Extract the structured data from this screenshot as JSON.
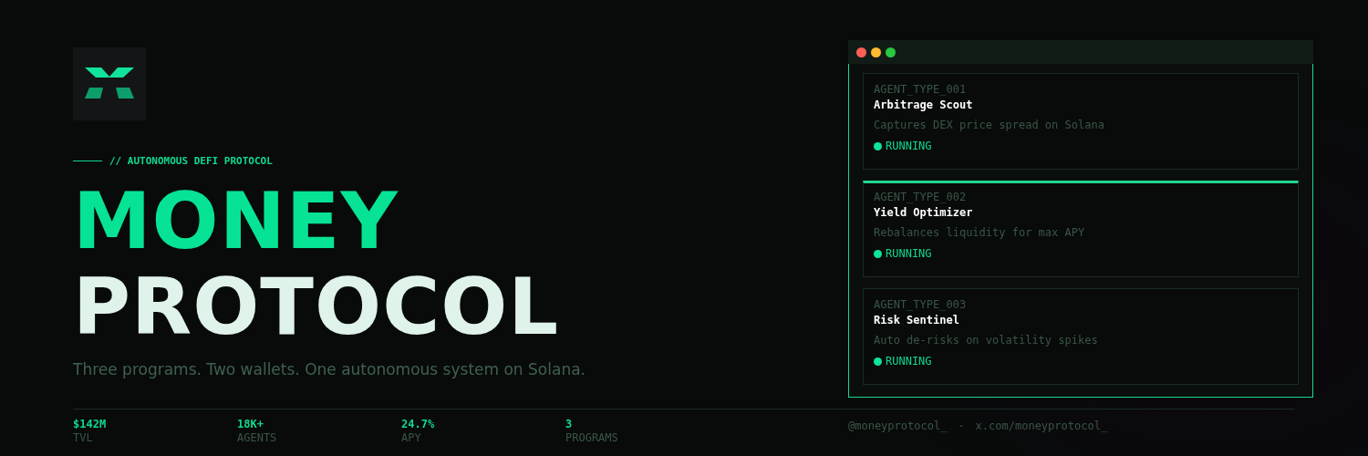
{
  "brand": {
    "tagline": "// AUTONOMOUS DEFI PROTOCOL",
    "title_line_1": "MONEY",
    "title_line_2": "PROTOCOL",
    "subtitle": "Three programs. Two wallets. One autonomous system on Solana."
  },
  "agents": [
    {
      "type": "AGENT_TYPE_001",
      "name": "Arbitrage Scout",
      "description": "Captures DEX price spread on Solana",
      "status": "RUNNING",
      "selected": false
    },
    {
      "type": "AGENT_TYPE_002",
      "name": "Yield Optimizer",
      "description": "Rebalances liquidity for max APY",
      "status": "RUNNING",
      "selected": true
    },
    {
      "type": "AGENT_TYPE_003",
      "name": "Risk Sentinel",
      "description": "Auto de-risks on volatility spikes",
      "status": "RUNNING",
      "selected": false
    }
  ],
  "stats": [
    {
      "value": "$142M",
      "label": "TVL"
    },
    {
      "value": "18K+",
      "label": "AGENTS"
    },
    {
      "value": "24.7%",
      "label": "APY"
    },
    {
      "value": "3",
      "label": "PROGRAMS"
    }
  ],
  "footer": {
    "handle": "@moneyprotocol_",
    "separator": "·",
    "link": "x.com/moneyprotocol_"
  }
}
